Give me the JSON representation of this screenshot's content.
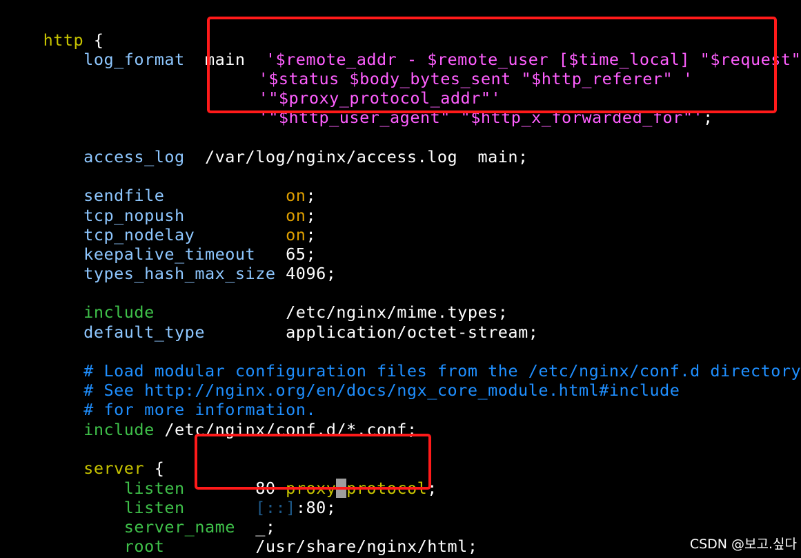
{
  "colors": {
    "background": "#000000",
    "keyword": "#c7c400",
    "directive": "#8ec7ff",
    "string": "#ff5fff",
    "on_value": "#e0a000",
    "include": "#3fc14a",
    "comment": "#1f8fff",
    "highlight_border": "#ff1a1a"
  },
  "code": {
    "http_kw": "http",
    "open_brace": " {",
    "log_format_dir": "    log_format",
    "log_format_name": "  main  ",
    "log_format_str1": "'$remote_addr - $remote_user [$time_local] \"$request\" '",
    "log_format_str2": "'$status $body_bytes_sent \"$http_referer\" '",
    "log_format_str3": "'\"$proxy_protocol_addr\"'",
    "log_format_str4": "'\"$http_user_agent\" \"$http_x_forwarded_for\"'",
    "log_format_end": ";",
    "access_log_dir": "    access_log",
    "access_log_val": "  /var/log/nginx/access.log  main;",
    "sendfile_dir": "    sendfile            ",
    "tcp_nopush_dir": "    tcp_nopush          ",
    "tcp_nodelay_dir": "    tcp_nodelay         ",
    "on_value": "on",
    "semicolon": ";",
    "keepalive_dir": "    keepalive_timeout   ",
    "keepalive_val": "65;",
    "types_hash_dir": "    types_hash_max_size ",
    "types_hash_val": "4096;",
    "include_kw_1": "    include             ",
    "include_val_1": "/etc/nginx/mime.types;",
    "default_type_dir": "    default_type        ",
    "default_type_val": "application/octet-stream;",
    "comment_1": "    # Load modular configuration files from the /etc/nginx/conf.d directory.",
    "comment_2": "    # See http://nginx.org/en/docs/ngx_core_module.html#include",
    "comment_3": "    # for more information.",
    "include_kw_2": "    include",
    "include_val_2": " /etc/nginx/conf.d/*.conf;",
    "server_kw": "    server",
    "server_brace": " {",
    "listen_dir_1": "        listen       ",
    "listen_val_1a": "80 ",
    "listen_val_1b": "proxy",
    "listen_cursor": "_",
    "listen_val_1c": "protocol",
    "listen_dir_2": "        listen       ",
    "listen_ipv6": "[::]",
    "listen_val_2": ":80;",
    "server_name_dir": "        server_name  ",
    "server_name_val": "_;",
    "root_dir": "        root         ",
    "root_val": "/usr/share/nginx/html;"
  },
  "watermark": "CSDN @보고.싶다"
}
